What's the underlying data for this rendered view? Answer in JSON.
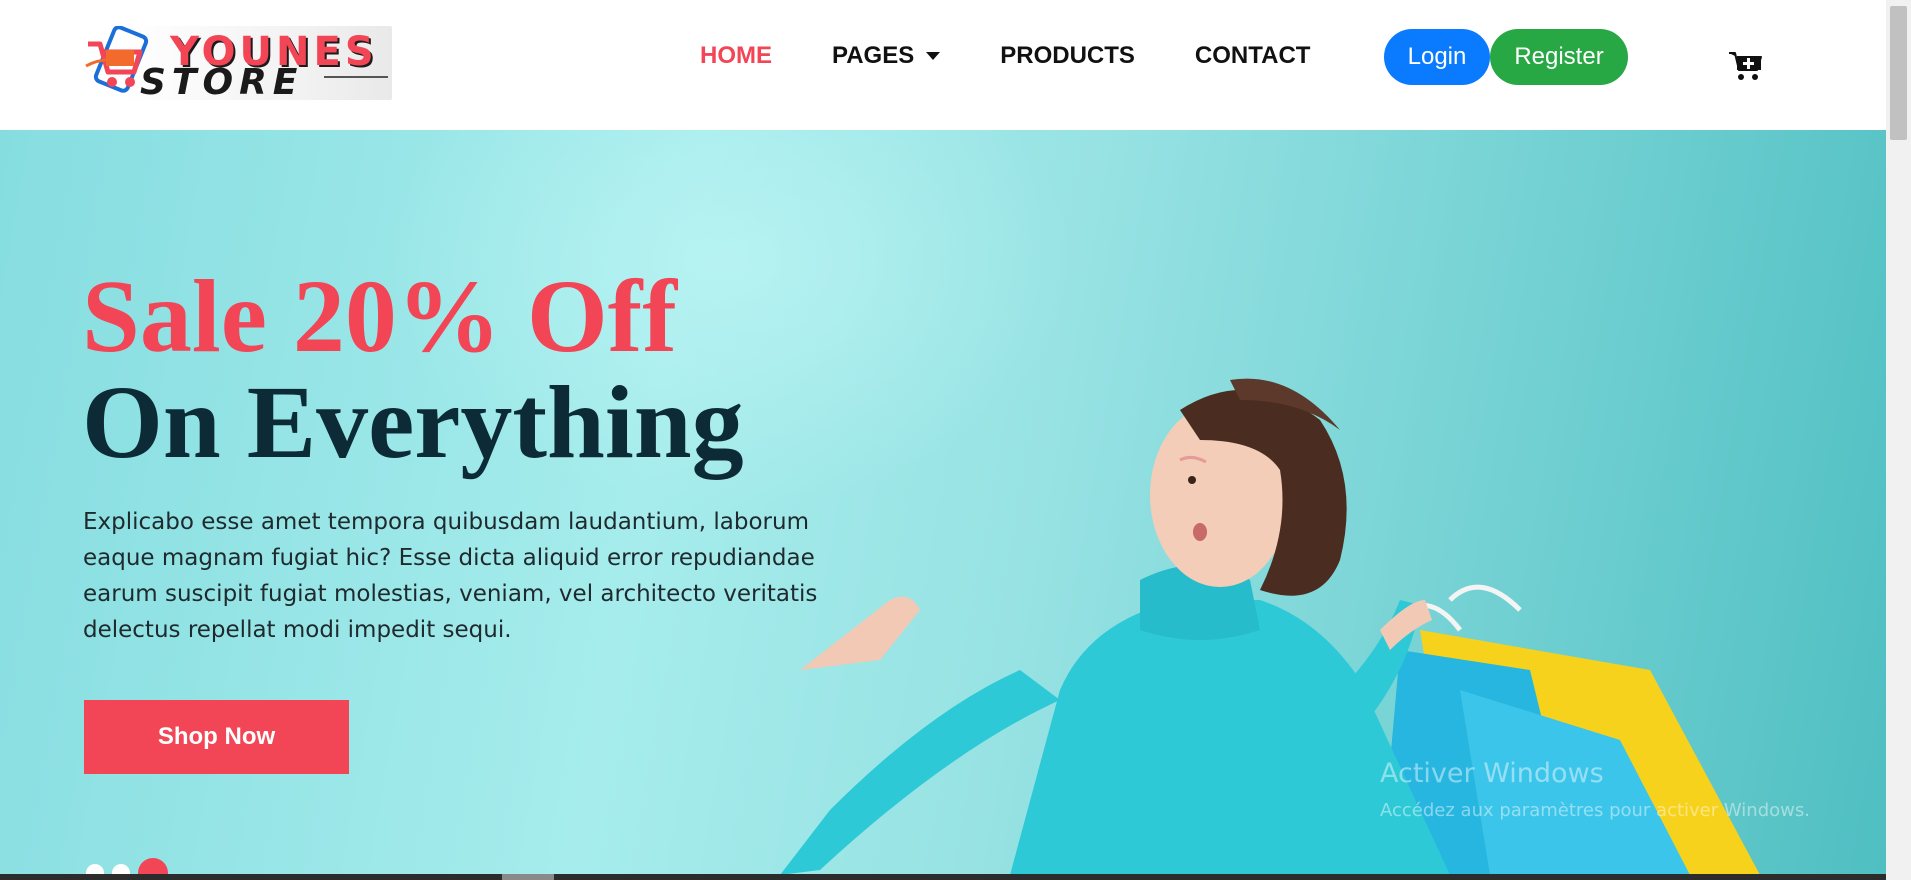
{
  "brand": {
    "line1": "YOUNES",
    "line2": "STORE",
    "accent_color": "#f24556",
    "dark_color": "#0c2b36"
  },
  "nav": {
    "items": [
      {
        "label": "HOME",
        "active": true
      },
      {
        "label": "PAGES",
        "has_dropdown": true
      },
      {
        "label": "PRODUCTS"
      },
      {
        "label": "CONTACT"
      }
    ],
    "login_label": "Login",
    "register_label": "Register",
    "login_color": "#0a7bff",
    "register_color": "#28a745",
    "cart_icon": "cart-plus-icon"
  },
  "hero": {
    "headline_line1": "Sale 20% Off",
    "headline_line2": "On Everything",
    "description": "Explicabo esse amet tempora quibusdam laudantium, laborum eaque magnam fugiat hic? Esse dicta aliquid error repudiandae earum suscipit fugiat molestias, veniam, vel architecto veritatis delectus repellat modi impedit sequi.",
    "cta_label": "Shop Now",
    "image": "woman-with-shopping-bags",
    "slide_count": 3,
    "active_slide": 3
  },
  "os_watermark": {
    "line1": "Activer Windows",
    "line2": "Accédez aux paramètres pour activer Windows."
  }
}
